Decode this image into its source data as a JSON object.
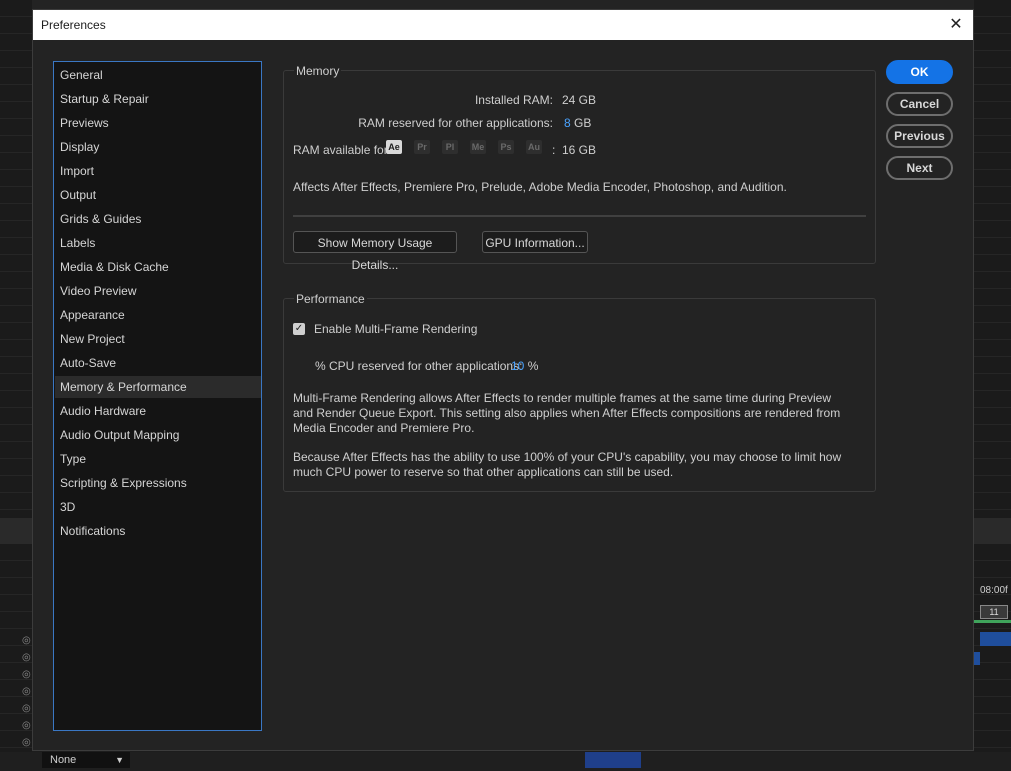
{
  "dialog": {
    "title": "Preferences",
    "close_glyph": "✕"
  },
  "categories": [
    "General",
    "Startup & Repair",
    "Previews",
    "Display",
    "Import",
    "Output",
    "Grids & Guides",
    "Labels",
    "Media & Disk Cache",
    "Video Preview",
    "Appearance",
    "New Project",
    "Auto-Save",
    "Memory & Performance",
    "Audio Hardware",
    "Audio Output Mapping",
    "Type",
    "Scripting & Expressions",
    "3D",
    "Notifications"
  ],
  "selected_category": "Memory & Performance",
  "memory": {
    "group_label": "Memory",
    "installed_label": "Installed RAM:",
    "installed_value": "24 GB",
    "reserved_label": "RAM reserved for other applications:",
    "reserved_value": "8",
    "reserved_unit": "GB",
    "available_label": "RAM available for",
    "apps": [
      {
        "abbr": "Ae",
        "active": true
      },
      {
        "abbr": "Pr",
        "active": false
      },
      {
        "abbr": "Pl",
        "active": false
      },
      {
        "abbr": "Me",
        "active": false
      },
      {
        "abbr": "Ps",
        "active": false
      },
      {
        "abbr": "Au",
        "active": false
      }
    ],
    "available_sep": ":",
    "available_value": "16 GB",
    "affects_text": "Affects After Effects, Premiere Pro, Prelude, Adobe Media Encoder, Photoshop, and Audition.",
    "usage_button": "Show Memory Usage Details...",
    "gpu_button": "GPU Information..."
  },
  "performance": {
    "group_label": "Performance",
    "mfr_label": "Enable Multi-Frame Rendering",
    "mfr_checked": true,
    "cpu_label": "% CPU reserved for other applications:",
    "cpu_value": "10",
    "cpu_unit": "%",
    "para1": "Multi-Frame Rendering allows After Effects to render multiple frames at the same time during Preview and Render Queue Export. This setting also applies when After Effects compositions are rendered from Media Encoder and Premiere Pro.",
    "para2": "Because After Effects has the ability to use 100% of your CPU's capability, you may choose to limit how much CPU power to reserve so that other applications can still be used."
  },
  "buttons": {
    "ok": "OK",
    "cancel": "Cancel",
    "previous": "Previous",
    "next": "Next"
  },
  "background": {
    "timecode": "08:00f",
    "frame": "11",
    "dropdown": "None"
  },
  "colors": {
    "accent": "#1473e6",
    "value_blue": "#4aa3ff",
    "list_border": "#3a77c4"
  }
}
